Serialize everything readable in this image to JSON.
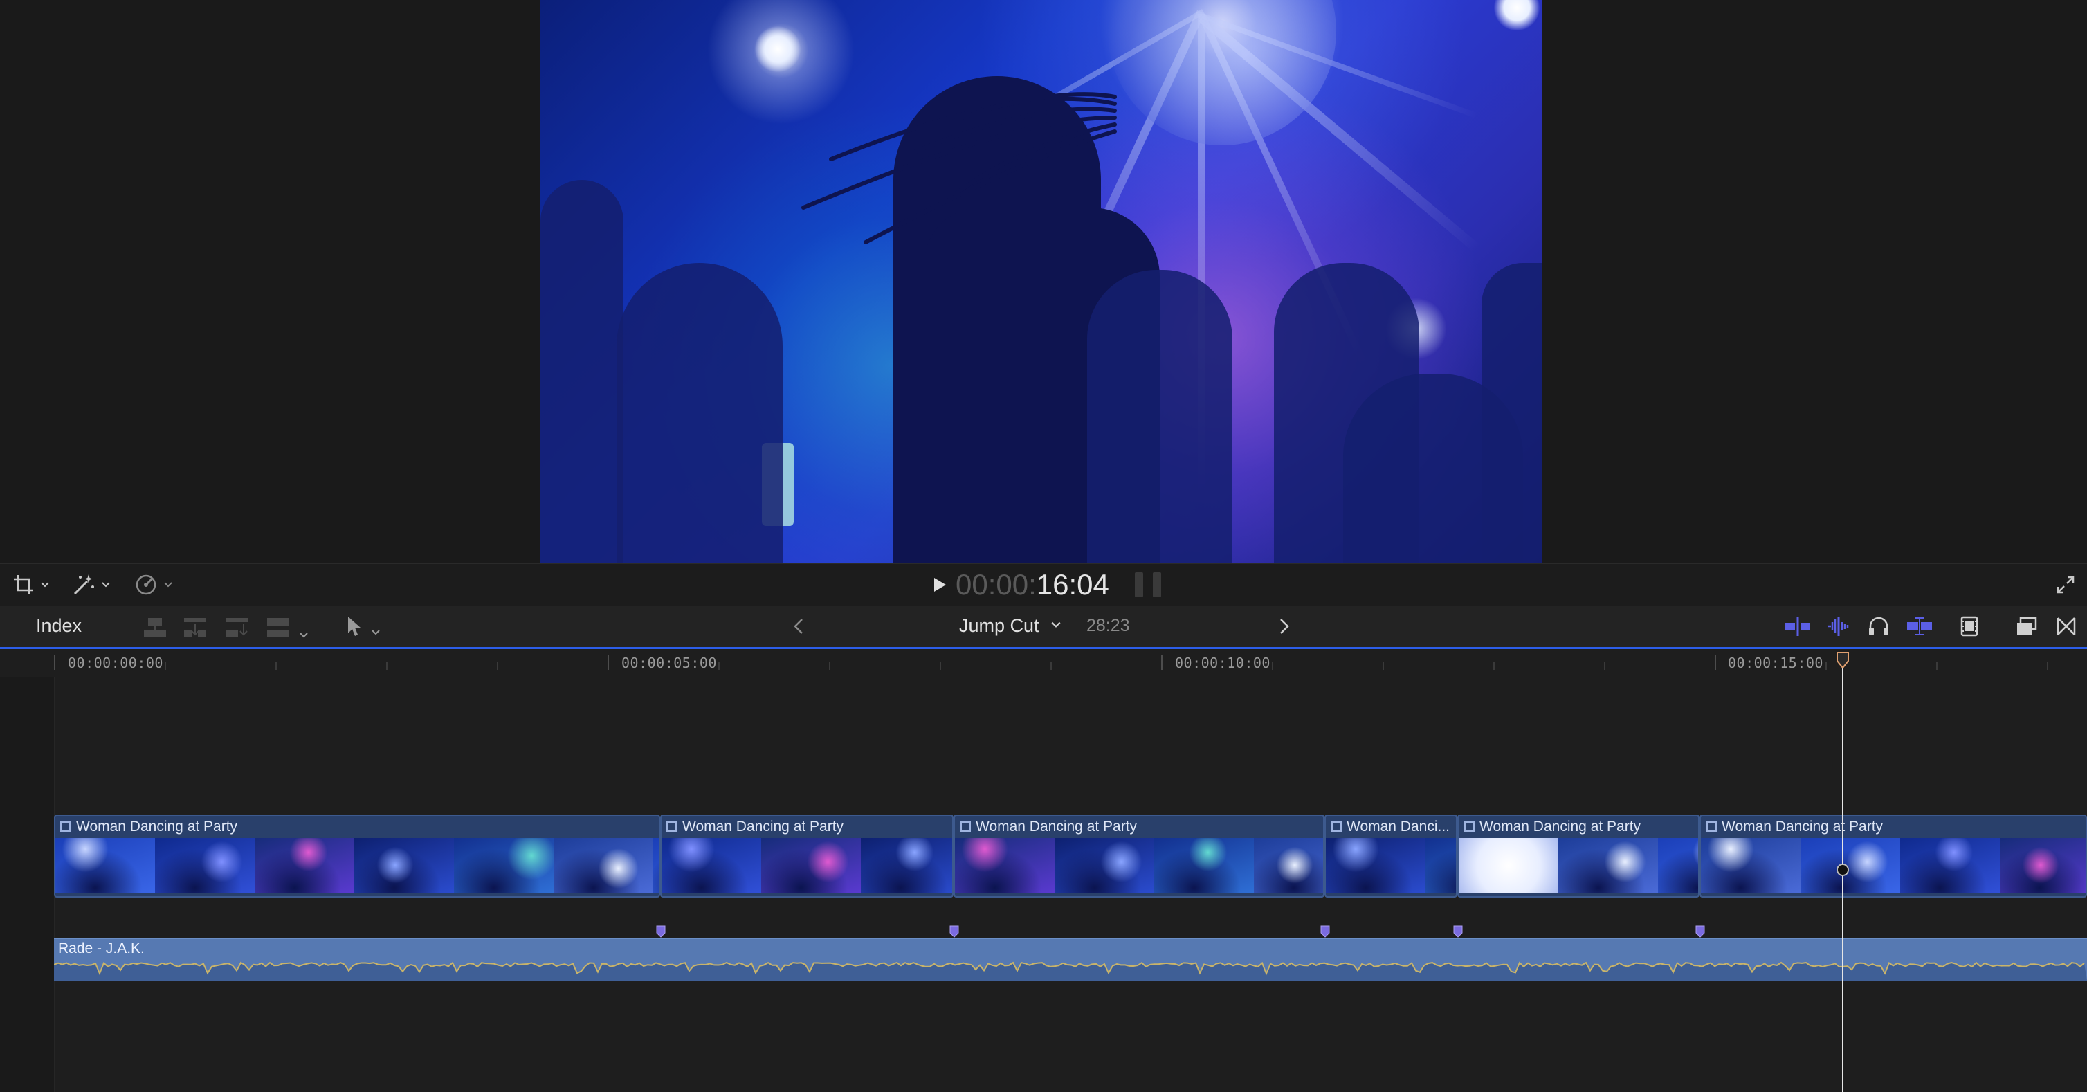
{
  "viewer": {
    "timecode_dim": "00:00:",
    "timecode_bright": "16:04"
  },
  "timeline_toolbar": {
    "index_label": "Index",
    "project_name": "Jump Cut",
    "project_duration": "28:23"
  },
  "ruler": {
    "labels": [
      "00:00:00:00",
      "00:00:05:00",
      "00:00:10:00",
      "00:00:15:00"
    ]
  },
  "clips": [
    {
      "title": "Woman Dancing at Party"
    },
    {
      "title": "Woman Dancing at Party"
    },
    {
      "title": "Woman Dancing at Party"
    },
    {
      "title": "Woman Danci..."
    },
    {
      "title": "Woman Dancing at Party"
    },
    {
      "title": "Woman Dancing at Party"
    }
  ],
  "audio": {
    "title": "Rade - J.A.K."
  },
  "icons": {
    "crop": "crop-icon",
    "magic_wand": "magic-wand-icon",
    "speed": "speed-gauge-icon",
    "fullscreen": "fullscreen-icon",
    "skimming": "skimming-icon",
    "audio_skimming": "audio-skimming-icon",
    "solo": "headphones-icon",
    "snapping": "snapping-icon",
    "clip_appearance": "filmstrip-icon",
    "effects_browser": "effects-browser-icon",
    "transitions_browser": "transitions-icon"
  },
  "colors": {
    "accent": "#2d5ee8",
    "clip_fill": "#29406b",
    "audio_fill": "#5679b2",
    "marker": "#7b6be0"
  }
}
